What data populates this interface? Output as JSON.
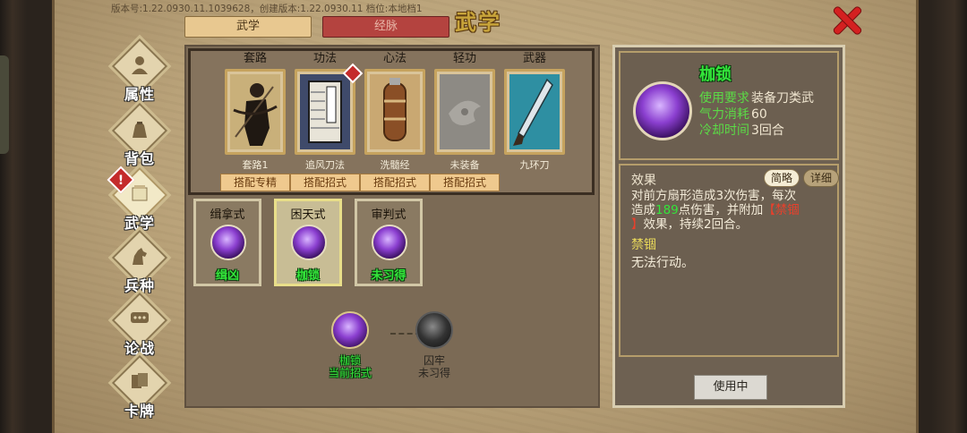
{
  "header": {
    "version": "版本号:1.22.0930.11.1039628，创建版本:1.22.0930.11  档位:本地档1",
    "title": "武学",
    "tabs": [
      "武学",
      "经脉"
    ]
  },
  "sidebar": {
    "items": [
      {
        "label": "属性",
        "icon": "person-icon"
      },
      {
        "label": "背包",
        "icon": "bag-icon"
      },
      {
        "label": "武学",
        "icon": "scroll-icon",
        "active": true,
        "alert": "!"
      },
      {
        "label": "兵种",
        "icon": "horse-icon"
      },
      {
        "label": "论战",
        "icon": "chat-icon"
      },
      {
        "label": "卡牌",
        "icon": "cards-icon"
      }
    ]
  },
  "slots": [
    {
      "category": "套路",
      "name": "套路1",
      "button": "搭配专精",
      "art": "swordsman-art"
    },
    {
      "category": "功法",
      "name": "追风刀法",
      "button": "搭配招式",
      "art": "book-art",
      "alert": true
    },
    {
      "category": "心法",
      "name": "洗髓经",
      "button": "搭配招式",
      "art": "scroll-art"
    },
    {
      "category": "轻功",
      "name": "未装备",
      "button": "搭配招式",
      "art": "empty-dragon-art"
    },
    {
      "category": "武器",
      "name": "九环刀",
      "button": "",
      "art": "blade-art"
    }
  ],
  "moves": [
    {
      "name": "缉拿式",
      "status": "缉凶",
      "selected": false
    },
    {
      "name": "困天式",
      "status": "枷锁",
      "selected": true
    },
    {
      "name": "审判式",
      "status": "未习得",
      "selected": false
    }
  ],
  "chain": [
    {
      "title": "枷锁",
      "sub": "当前招式",
      "learned": true
    },
    {
      "title": "囚牢",
      "sub": "未习得",
      "learned": false
    }
  ],
  "detail": {
    "name": "枷锁",
    "stats": [
      {
        "key": "使用要求",
        "value": "装备刀类武"
      },
      {
        "key": "气力消耗",
        "value": "60"
      },
      {
        "key": "冷却时间",
        "value": "3回合"
      }
    ],
    "effect_title": "效果",
    "brief_label": "简略",
    "detail_label": "详细",
    "effect_line1": "对前方扇形造成3次伤害，每次",
    "effect_line2_a": "造成",
    "effect_damage": "189",
    "effect_line2_b": "点伤害，并附加",
    "effect_tag_open": "【禁锢",
    "effect_tag_close": "】",
    "effect_line3": "效果，持续2回合。",
    "status_name": "禁锢",
    "status_desc": "无法行动。",
    "in_use_label": "使用中"
  },
  "colors": {
    "accent_green": "#33e53a",
    "title_gold": "#c8a43a",
    "close_red": "#d42020",
    "tag_red": "#e8402c"
  }
}
